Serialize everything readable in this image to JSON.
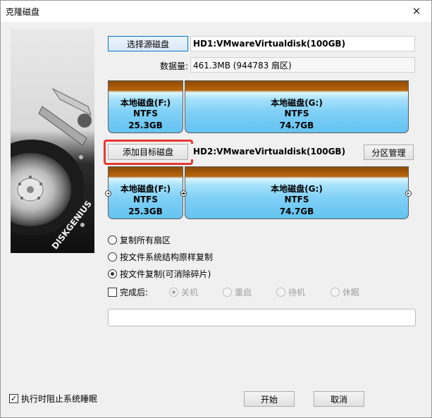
{
  "window": {
    "title": "克隆磁盘",
    "close_symbol": "✕"
  },
  "side_image": {
    "logo_text": "DISKGENIUS"
  },
  "source": {
    "select_button": "选择源磁盘",
    "disk_name": "HD1:VMwareVirtualdisk(100GB)",
    "data_label": "数据量:",
    "data_value": "461.3MB (944783 扇区)",
    "partitions": [
      {
        "name": "本地磁盘(F:)",
        "fs": "NTFS",
        "size": "25.3GB"
      },
      {
        "name": "本地磁盘(G:)",
        "fs": "NTFS",
        "size": "74.7GB"
      }
    ]
  },
  "target": {
    "add_button": "添加目标磁盘",
    "disk_name": "HD2:VMwareVirtualdisk(100GB)",
    "partition_manage_button": "分区管理",
    "partitions": [
      {
        "name": "本地磁盘(F:)",
        "fs": "NTFS",
        "size": "25.3GB"
      },
      {
        "name": "本地磁盘(G:)",
        "fs": "NTFS",
        "size": "74.7GB"
      }
    ]
  },
  "options": {
    "copy_all_sectors": "复制所有扇区",
    "copy_fs_structure": "按文件系统结构原样复制",
    "copy_by_file": "按文件复制(可消除碎片)",
    "selected": "copy_by_file"
  },
  "after_complete": {
    "label": "完成后:",
    "choices": [
      "关机",
      "重启",
      "待机",
      "休眠"
    ],
    "selected": "关机"
  },
  "footer": {
    "prevent_sleep": "执行时阻止系统睡眠",
    "prevent_sleep_checked": true,
    "start_button": "开始",
    "cancel_button": "取消"
  }
}
